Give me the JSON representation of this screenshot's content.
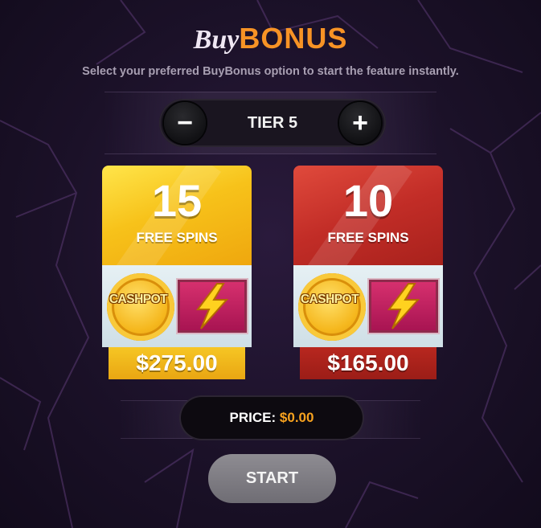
{
  "header": {
    "title_buy": "Buy",
    "title_bonus": "BONUS",
    "subtitle": "Select your preferred BuyBonus option to start the feature instantly."
  },
  "tier": {
    "minus_label": "−",
    "plus_label": "+",
    "label": "TIER 5"
  },
  "cards": [
    {
      "spins": "15",
      "spins_text": "FREE SPINS",
      "coin_label": "CASHPOT",
      "price": "$275.00",
      "color": "#f7c21a"
    },
    {
      "spins": "10",
      "spins_text": "FREE SPINS",
      "coin_label": "CASHPOT",
      "price": "$165.00",
      "color": "#c22d27"
    }
  ],
  "price_bar": {
    "label": "PRICE:",
    "value": "$0.00"
  },
  "start_label": "START",
  "colors": {
    "accent_orange": "#f79325",
    "price_value": "#f7a21f",
    "background": "#1b1128"
  }
}
